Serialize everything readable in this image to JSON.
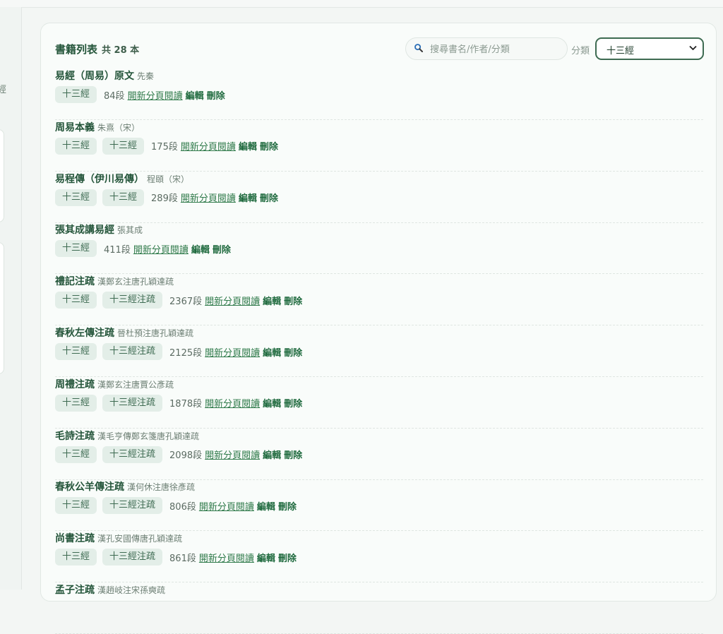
{
  "header": {
    "title": "書籍列表",
    "count": "共 28 本",
    "search_placeholder": "搜尋書名/作者/分類",
    "category_label": "分類",
    "category_selected": "十三經"
  },
  "left": {
    "glyph": "經"
  },
  "labels": {
    "read": "開新分頁閱讀",
    "edit": "編輯",
    "delete": "刪除"
  },
  "colors": {
    "accent": "#24553a",
    "tag_bg": "#e3eee8",
    "link": "#2f7a4a"
  },
  "books": [
    {
      "name": "易經（周易）原文",
      "author": "先秦",
      "tags": [
        "十三經"
      ],
      "segments": "84段"
    },
    {
      "name": "周易本義",
      "author": "朱熹（宋）",
      "tags": [
        "十三經",
        "十三經"
      ],
      "segments": "175段"
    },
    {
      "name": "易程傳（伊川易傳）",
      "author": "程頤（宋）",
      "tags": [
        "十三經",
        "十三經"
      ],
      "segments": "289段"
    },
    {
      "name": "張其成講易經",
      "author": "張其成",
      "tags": [
        "十三經"
      ],
      "segments": "411段"
    },
    {
      "name": "禮記注疏",
      "author": "漢鄭玄注唐孔穎達疏",
      "tags": [
        "十三經",
        "十三經注疏"
      ],
      "segments": "2367段"
    },
    {
      "name": "春秋左傳注疏",
      "author": "晉杜預注唐孔穎達疏",
      "tags": [
        "十三經",
        "十三經注疏"
      ],
      "segments": "2125段"
    },
    {
      "name": "周禮注疏",
      "author": "漢鄭玄注唐賈公彥疏",
      "tags": [
        "十三經",
        "十三經注疏"
      ],
      "segments": "1878段"
    },
    {
      "name": "毛詩注疏",
      "author": "漢毛亨傳鄭玄箋唐孔穎達疏",
      "tags": [
        "十三經",
        "十三經注疏"
      ],
      "segments": "2098段"
    },
    {
      "name": "春秋公羊傳注疏",
      "author": "漢何休注唐徐彥疏",
      "tags": [
        "十三經",
        "十三經注疏"
      ],
      "segments": "806段"
    },
    {
      "name": "尚書注疏",
      "author": "漢孔安國傳唐孔穎達疏",
      "tags": [
        "十三經",
        "十三經注疏"
      ],
      "segments": "861段"
    },
    {
      "name": "孟子注疏",
      "author": "漢趙岐注宋孫奭疏",
      "tags": [],
      "segments": ""
    }
  ]
}
